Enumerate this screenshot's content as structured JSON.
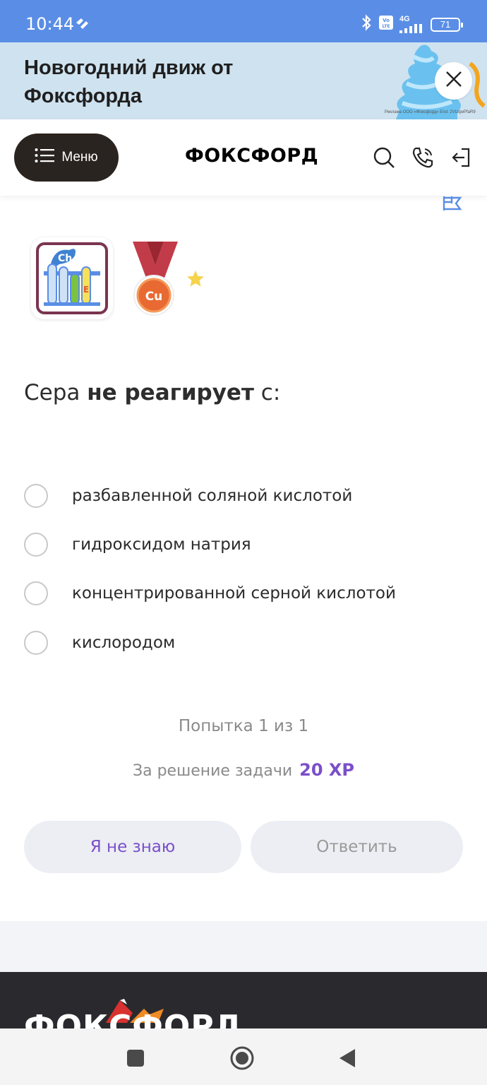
{
  "status_bar": {
    "time": "10:44",
    "network": "4G",
    "volte": "Vo LTE",
    "battery": "71"
  },
  "promo": {
    "title": "Новогодний движ от Фоксфорда",
    "fine_print": "Реклама ООО «Фоксфорд» Erid: 2VtzqwPfaR9"
  },
  "header": {
    "menu_label": "Меню",
    "logo": "ФОКСФОРД"
  },
  "badges": {
    "tubes_label": "Ch",
    "tube_letter": "E",
    "medal_label": "Cu"
  },
  "question": {
    "before": "Сера ",
    "emphasis": "не реагирует",
    "after": " с:"
  },
  "options": [
    "разбавленной соляной кислотой",
    "гидроксидом натрия",
    "концентрированной серной кислотой",
    "кислородом"
  ],
  "attempt_text": "Попытка 1 из 1",
  "reward": {
    "label": "За решение задачи",
    "xp": "20 XP"
  },
  "buttons": {
    "dont_know": "Я не знаю",
    "answer": "Ответить"
  },
  "footer": {
    "logo": "ФОКСФОРД"
  },
  "colors": {
    "status_bar": "#5a8ee6",
    "promo_bg": "#cfe2ef",
    "accent_purple": "#7b4fc9",
    "menu_button": "#2a2420",
    "footer_bg": "#2a2a2e"
  }
}
